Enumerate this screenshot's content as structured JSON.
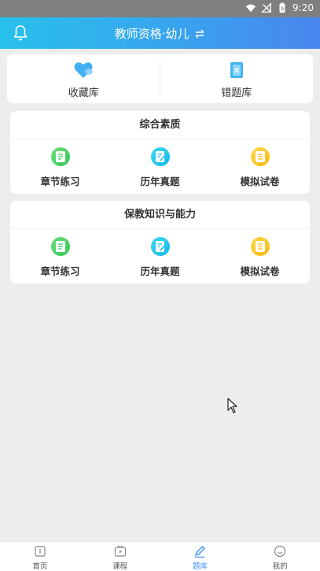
{
  "status_bar": {
    "time": "9:20",
    "battery_level": "9"
  },
  "header": {
    "title": "教师资格·幼儿",
    "swap_icon": "swap-arrows-icon",
    "bell_icon": "bell-icon"
  },
  "quick_links": [
    {
      "label": "收藏库",
      "icon": "favorites-heart-icon"
    },
    {
      "label": "错题库",
      "icon": "wrong-questions-icon"
    }
  ],
  "sections": [
    {
      "title": "综合素质",
      "items": [
        {
          "label": "章节练习",
          "icon": "chapter-practice-icon",
          "color": "#38cc5c"
        },
        {
          "label": "历年真题",
          "icon": "past-exams-icon",
          "color": "#1bbbe9"
        },
        {
          "label": "模拟试卷",
          "icon": "mock-exam-icon",
          "color": "#fbbd16"
        }
      ]
    },
    {
      "title": "保教知识与能力",
      "items": [
        {
          "label": "章节练习",
          "icon": "chapter-practice-icon",
          "color": "#38cc5c"
        },
        {
          "label": "历年真题",
          "icon": "past-exams-icon",
          "color": "#1bbbe9"
        },
        {
          "label": "模拟试卷",
          "icon": "mock-exam-icon",
          "color": "#fbbd16"
        }
      ]
    }
  ],
  "tabbar": {
    "active_color": "#3a8ff0",
    "tabs": [
      {
        "label": "首页",
        "icon": "home-icon",
        "active": false
      },
      {
        "label": "课程",
        "icon": "course-icon",
        "active": false
      },
      {
        "label": "题库",
        "icon": "question-bank-icon",
        "active": true
      },
      {
        "label": "我的",
        "icon": "profile-icon",
        "active": false
      }
    ]
  }
}
